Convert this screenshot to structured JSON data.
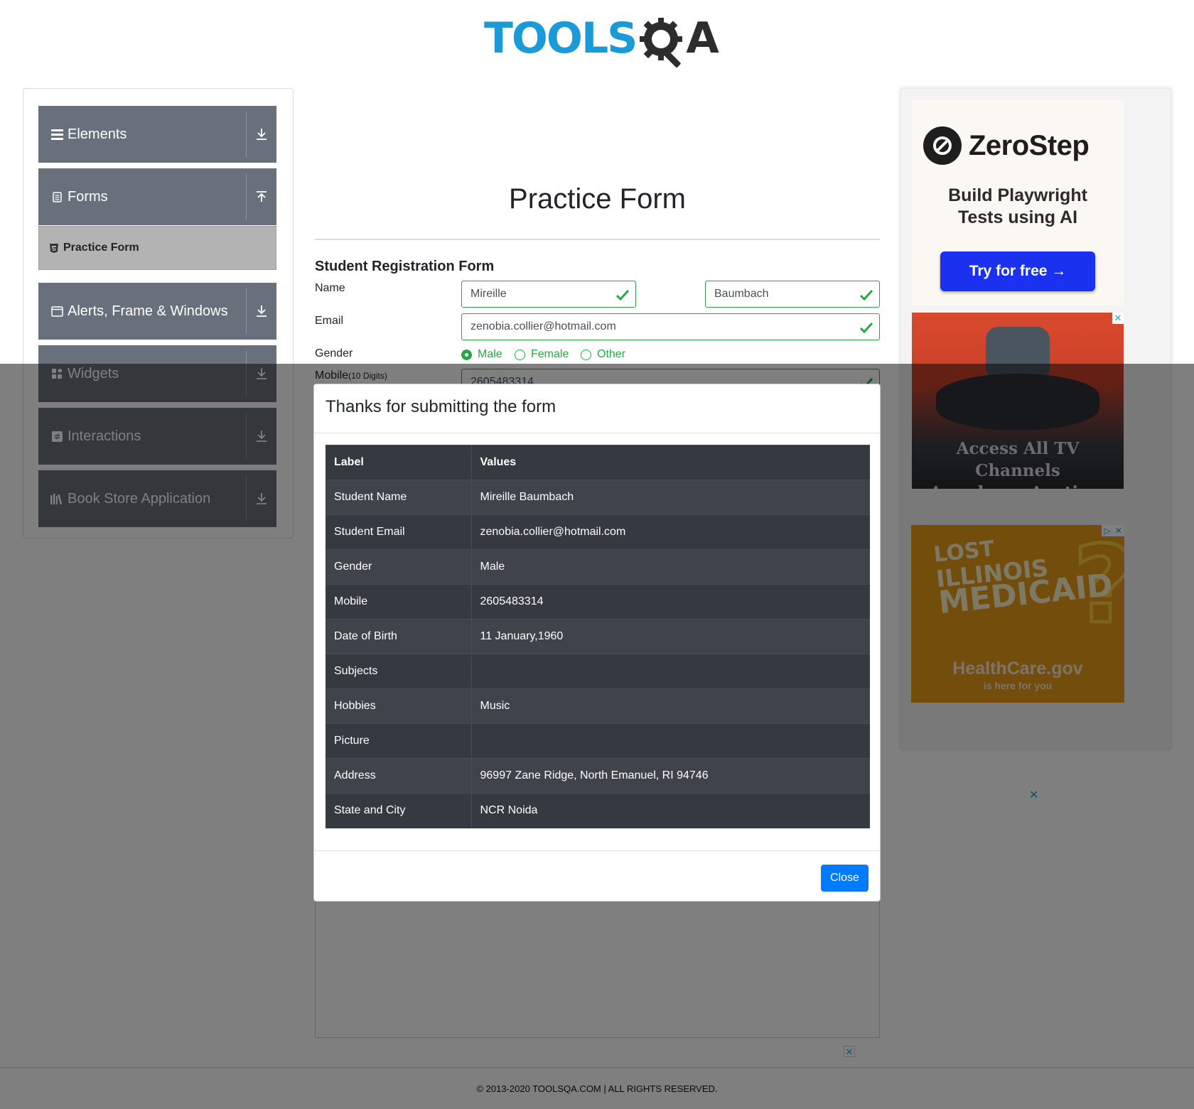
{
  "logo": {
    "brand_main": "TOOLS",
    "brand_q": "Q",
    "brand_a": "A"
  },
  "sidebar": {
    "groups": [
      {
        "label": "Elements",
        "icon": "hamburger-icon",
        "toggle": "download-arrow-icon"
      },
      {
        "label": "Forms",
        "icon": "document-icon",
        "toggle": "upload-arrow-icon"
      },
      {
        "label": "Alerts, Frame & Windows",
        "icon": "window-icon",
        "toggle": "download-arrow-icon"
      },
      {
        "label": "Widgets",
        "icon": "widgets-icon",
        "toggle": "download-arrow-icon"
      },
      {
        "label": "Interactions",
        "icon": "interactions-icon",
        "toggle": "download-arrow-icon"
      },
      {
        "label": "Book Store Application",
        "icon": "books-icon",
        "toggle": "download-arrow-icon"
      }
    ],
    "active_subitem": {
      "label": "Practice Form",
      "icon": "html5-icon"
    }
  },
  "main": {
    "title": "Practice Form",
    "subtitle": "Student Registration Form",
    "labels": {
      "name": "Name",
      "email": "Email",
      "gender": "Gender",
      "mobile": "Mobile",
      "mobile_hint": "(10 Digits)"
    },
    "first_name": "Mireille",
    "last_name": "Baumbach",
    "email": "zenobia.collier@hotmail.com",
    "gender_options": [
      "Male",
      "Female",
      "Other"
    ],
    "gender_selected": "Male",
    "mobile": "2605483314"
  },
  "modal": {
    "title": "Thanks for submitting the form",
    "headers": [
      "Label",
      "Values"
    ],
    "rows": [
      [
        "Student Name",
        "Mireille Baumbach"
      ],
      [
        "Student Email",
        "zenobia.collier@hotmail.com"
      ],
      [
        "Gender",
        "Male"
      ],
      [
        "Mobile",
        "2605483314"
      ],
      [
        "Date of Birth",
        "11 January,1960"
      ],
      [
        "Subjects",
        ""
      ],
      [
        "Hobbies",
        "Music"
      ],
      [
        "Picture",
        ""
      ],
      [
        "Address",
        "96997 Zane Ridge, North Emanuel, RI 94746"
      ],
      [
        "State and City",
        "NCR Noida"
      ]
    ],
    "close_label": "Close"
  },
  "ads": {
    "zerostep": {
      "name": "ZeroStep",
      "tagline_1": "Build Playwright",
      "tagline_2": "Tests using AI",
      "cta": "Try for free →"
    },
    "tv": {
      "line1": "Access All TV Channels",
      "line2": "Anywhere, Anytime"
    },
    "medicaid": {
      "line1": "LOST",
      "line2": "ILLINOIS",
      "line3": "MEDICAID",
      "brand": "HealthCare.gov",
      "tagline": "is here for you"
    },
    "close_glyph": "✕",
    "adchoice_glyph": "▷"
  },
  "footer": {
    "text": "© 2013-2020 TOOLSQA.COM | ALL RIGHTS RESERVED."
  },
  "colors": {
    "brand_blue": "#1a9ad6",
    "success": "#28a745",
    "primary": "#007bff",
    "sidebar_group": "#68717b"
  }
}
